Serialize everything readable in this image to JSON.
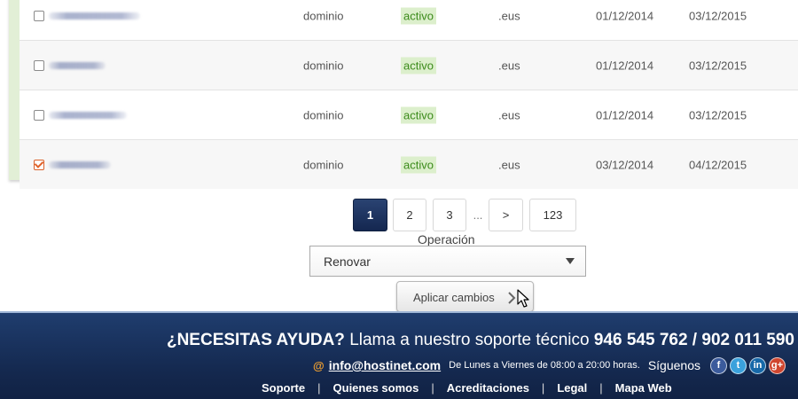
{
  "table": {
    "rows": [
      {
        "type": "dominio",
        "status": "activo",
        "extension": ".eus",
        "start_date": "01/12/2014",
        "end_date": "03/12/2015",
        "checked": false
      },
      {
        "type": "dominio",
        "status": "activo",
        "extension": ".eus",
        "start_date": "01/12/2014",
        "end_date": "03/12/2015",
        "checked": false
      },
      {
        "type": "dominio",
        "status": "activo",
        "extension": ".eus",
        "start_date": "01/12/2014",
        "end_date": "03/12/2015",
        "checked": false
      },
      {
        "type": "dominio",
        "status": "activo",
        "extension": ".eus",
        "start_date": "03/12/2014",
        "end_date": "04/12/2015",
        "checked": true
      }
    ]
  },
  "pagination": {
    "pages": [
      "1",
      "2",
      "3"
    ],
    "current": "1",
    "ellipsis": "...",
    "next": ">",
    "last": "123"
  },
  "operation": {
    "label": "Operación",
    "selected": "Renovar",
    "apply_label": "Aplicar cambios"
  },
  "footer": {
    "help_prefix": "¿NECESITAS AYUDA?",
    "help_middle": " Llama a nuestro soporte técnico ",
    "phone_1": "946 545 762",
    "phone_sep": " / ",
    "phone_2": "902 011 590",
    "at_symbol": "@",
    "email": "info@hostinet.com",
    "hours": "De Lunes a Viernes de 08:00 a 20:00 horas.",
    "follow": "Síguenos",
    "social": [
      {
        "name": "facebook",
        "glyph": "f"
      },
      {
        "name": "twitter",
        "glyph": "t"
      },
      {
        "name": "linkedin",
        "glyph": "in"
      },
      {
        "name": "google-plus",
        "glyph": "g+"
      }
    ],
    "links": [
      "Soporte",
      "Quienes somos",
      "Acreditaciones",
      "Legal",
      "Mapa Web"
    ],
    "link_separator": "|"
  },
  "colors": {
    "accent_dark_blue": "#142750",
    "status_green_bg": "#dcefcc",
    "status_green_text": "#3b8a1a",
    "checkbox_orange": "#e0632b",
    "email_icon_orange": "#f0a030"
  }
}
